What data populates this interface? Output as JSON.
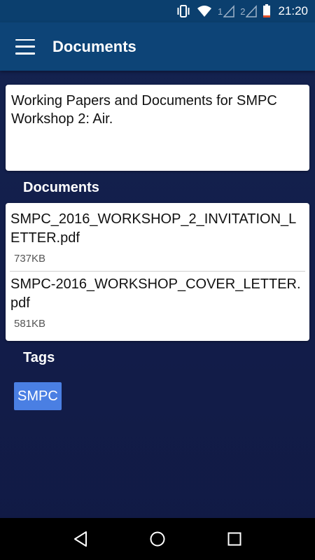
{
  "status_bar": {
    "sim1_label": "1",
    "sim2_label": "2",
    "time": "21:20"
  },
  "app_bar": {
    "title": "Documents"
  },
  "description": {
    "text": "Working Papers and Documents for SMPC Workshop 2: Air."
  },
  "documents": {
    "heading": "Documents",
    "items": [
      {
        "name": "SMPC_2016_WORKSHOP_2_INVITATION_LETTER.pdf",
        "size": "737KB"
      },
      {
        "name": "SMPC-2016_WORKSHOP_COVER_LETTER.pdf",
        "size": "581KB"
      }
    ]
  },
  "tags": {
    "heading": "Tags",
    "items": [
      "SMPC"
    ]
  },
  "colors": {
    "app_bar": "#0d4477",
    "status_bar": "#0b3f6e",
    "background": "#142350",
    "tag_chip": "#4a7fe3"
  }
}
